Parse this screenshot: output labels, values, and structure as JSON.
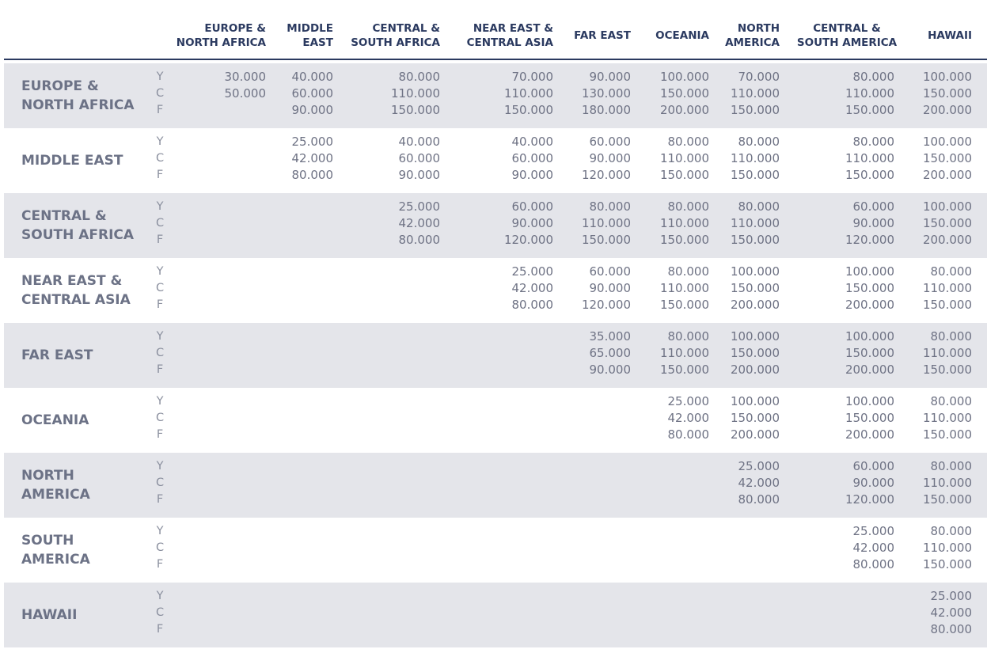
{
  "columns": [
    {
      "lines": [
        "EUROPE &",
        "NORTH AFRICA"
      ]
    },
    {
      "lines": [
        "MIDDLE",
        "EAST"
      ]
    },
    {
      "lines": [
        "CENTRAL &",
        "SOUTH AFRICA"
      ]
    },
    {
      "lines": [
        "NEAR EAST &",
        "CENTRAL ASIA"
      ]
    },
    {
      "lines": [
        "FAR EAST"
      ]
    },
    {
      "lines": [
        "OCEANIA"
      ]
    },
    {
      "lines": [
        "NORTH",
        "AMERICA"
      ]
    },
    {
      "lines": [
        "CENTRAL &",
        "SOUTH AMERICA"
      ]
    },
    {
      "lines": [
        "HAWAII"
      ]
    }
  ],
  "classes": [
    "Y",
    "C",
    "F"
  ],
  "rows": [
    {
      "lines": [
        "EUROPE &",
        "NORTH AFRICA"
      ],
      "cells": [
        [
          "30.000",
          "50.000"
        ],
        [
          "40.000",
          "60.000",
          "90.000"
        ],
        [
          "80.000",
          "110.000",
          "150.000"
        ],
        [
          "70.000",
          "110.000",
          "150.000"
        ],
        [
          "90.000",
          "130.000",
          "180.000"
        ],
        [
          "100.000",
          "150.000",
          "200.000"
        ],
        [
          "70.000",
          "110.000",
          "150.000"
        ],
        [
          "80.000",
          "110.000",
          "150.000"
        ],
        [
          "100.000",
          "150.000",
          "200.000"
        ]
      ]
    },
    {
      "lines": [
        "MIDDLE EAST"
      ],
      "cells": [
        [],
        [
          "25.000",
          "42.000",
          "80.000"
        ],
        [
          "40.000",
          "60.000",
          "90.000"
        ],
        [
          "40.000",
          "60.000",
          "90.000"
        ],
        [
          "60.000",
          "90.000",
          "120.000"
        ],
        [
          "80.000",
          "110.000",
          "150.000"
        ],
        [
          "80.000",
          "110.000",
          "150.000"
        ],
        [
          "80.000",
          "110.000",
          "150.000"
        ],
        [
          "100.000",
          "150.000",
          "200.000"
        ]
      ]
    },
    {
      "lines": [
        "CENTRAL &",
        "SOUTH AFRICA"
      ],
      "cells": [
        [],
        [],
        [
          "25.000",
          "42.000",
          "80.000"
        ],
        [
          "60.000",
          "90.000",
          "120.000"
        ],
        [
          "80.000",
          "110.000",
          "150.000"
        ],
        [
          "80.000",
          "110.000",
          "150.000"
        ],
        [
          "80.000",
          "110.000",
          "150.000"
        ],
        [
          "60.000",
          "90.000",
          "120.000"
        ],
        [
          "100.000",
          "150.000",
          "200.000"
        ]
      ]
    },
    {
      "lines": [
        "NEAR EAST &",
        "CENTRAL ASIA"
      ],
      "cells": [
        [],
        [],
        [],
        [
          "25.000",
          "42.000",
          "80.000"
        ],
        [
          "60.000",
          "90.000",
          "120.000"
        ],
        [
          "80.000",
          "110.000",
          "150.000"
        ],
        [
          "100.000",
          "150.000",
          "200.000"
        ],
        [
          "100.000",
          "150.000",
          "200.000"
        ],
        [
          "80.000",
          "110.000",
          "150.000"
        ]
      ]
    },
    {
      "lines": [
        "FAR EAST"
      ],
      "cells": [
        [],
        [],
        [],
        [],
        [
          "35.000",
          "65.000",
          "90.000"
        ],
        [
          "80.000",
          "110.000",
          "150.000"
        ],
        [
          "100.000",
          "150.000",
          "200.000"
        ],
        [
          "100.000",
          "150.000",
          "200.000"
        ],
        [
          "80.000",
          "110.000",
          "150.000"
        ]
      ]
    },
    {
      "lines": [
        "OCEANIA"
      ],
      "cells": [
        [],
        [],
        [],
        [],
        [],
        [
          "25.000",
          "42.000",
          "80.000"
        ],
        [
          "100.000",
          "150.000",
          "200.000"
        ],
        [
          "100.000",
          "150.000",
          "200.000"
        ],
        [
          "80.000",
          "110.000",
          "150.000"
        ]
      ]
    },
    {
      "lines": [
        "NORTH",
        "AMERICA"
      ],
      "cells": [
        [],
        [],
        [],
        [],
        [],
        [],
        [
          "25.000",
          "42.000",
          "80.000"
        ],
        [
          "60.000",
          "90.000",
          "120.000"
        ],
        [
          "80.000",
          "110.000",
          "150.000"
        ]
      ]
    },
    {
      "lines": [
        "SOUTH",
        "AMERICA"
      ],
      "cells": [
        [],
        [],
        [],
        [],
        [],
        [],
        [],
        [
          "25.000",
          "42.000",
          "80.000"
        ],
        [
          "80.000",
          "110.000",
          "150.000"
        ]
      ]
    },
    {
      "lines": [
        "HAWAII"
      ],
      "cells": [
        [],
        [],
        [],
        [],
        [],
        [],
        [],
        [],
        [
          "25.000",
          "42.000",
          "80.000"
        ]
      ]
    }
  ]
}
